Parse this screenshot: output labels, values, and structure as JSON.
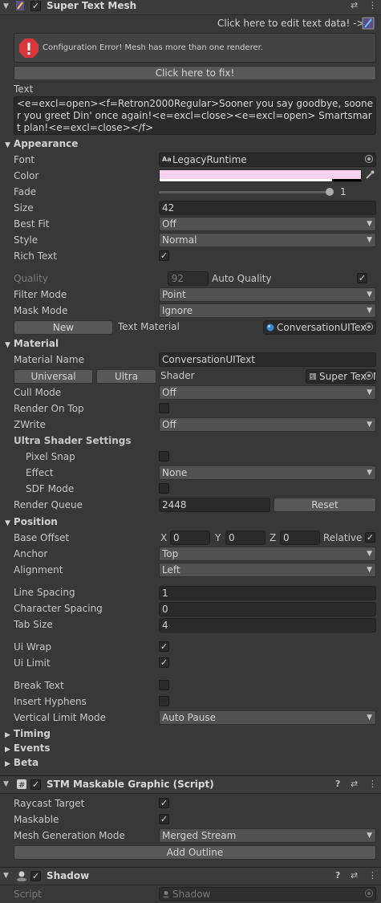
{
  "super_text_mesh": {
    "title": "Super Text Mesh",
    "edit_link": "Click here to edit text data! ->",
    "error_text": "Configuration Error! Mesh has more than one renderer.",
    "fix_button": "Click here to fix!",
    "text_label": "Text",
    "text_value": "<e=excl=open><f=Retron2000Regular>Sooner you say goodbye, sooner you greet Din' once again!<e=excl=close><e=excl=open> Smartsmart plan!<e=excl=close></f>",
    "appearance": {
      "header": "Appearance",
      "font_label": "Font",
      "font_value": "LegacyRuntime",
      "font_prefix": "Aa",
      "color_label": "Color",
      "color_value": "#f6d0ef",
      "fade_label": "Fade",
      "fade_value": "1",
      "size_label": "Size",
      "size_value": "42",
      "best_fit_label": "Best Fit",
      "best_fit_value": "Off",
      "style_label": "Style",
      "style_value": "Normal",
      "rich_text_label": "Rich Text",
      "quality_label": "Quality",
      "quality_value": "92",
      "auto_quality_label": "Auto Quality",
      "filter_mode_label": "Filter Mode",
      "filter_mode_value": "Point",
      "mask_mode_label": "Mask Mode",
      "mask_mode_value": "Ignore",
      "new_button": "New",
      "text_material_label": "Text Material",
      "text_material_value": "ConversationUIText"
    },
    "material": {
      "header": "Material",
      "name_label": "Material Name",
      "name_value": "ConversationUIText",
      "universal_button": "Universal",
      "ultra_button": "Ultra",
      "shader_label": "Shader",
      "shader_value": "Super Text Mesh",
      "cull_mode_label": "Cull Mode",
      "cull_mode_value": "Off",
      "render_on_top_label": "Render On Top",
      "zwrite_label": "ZWrite",
      "zwrite_value": "Off",
      "ultra_settings_label": "Ultra Shader Settings",
      "pixel_snap_label": "Pixel Snap",
      "effect_label": "Effect",
      "effect_value": "None",
      "sdf_mode_label": "SDF Mode",
      "render_queue_label": "Render Queue",
      "render_queue_value": "2448",
      "reset_button": "Reset"
    },
    "position": {
      "header": "Position",
      "base_offset_label": "Base Offset",
      "x_label": "X",
      "x_value": "0",
      "y_label": "Y",
      "y_value": "0",
      "z_label": "Z",
      "z_value": "0",
      "relative_label": "Relative",
      "anchor_label": "Anchor",
      "anchor_value": "Top",
      "alignment_label": "Alignment",
      "alignment_value": "Left",
      "line_spacing_label": "Line Spacing",
      "line_spacing_value": "1",
      "char_spacing_label": "Character Spacing",
      "char_spacing_value": "0",
      "tab_size_label": "Tab Size",
      "tab_size_value": "4",
      "ui_wrap_label": "Ui Wrap",
      "ui_limit_label": "Ui Limit",
      "break_text_label": "Break Text",
      "insert_hyphens_label": "Insert Hyphens",
      "vertical_limit_label": "Vertical Limit Mode",
      "vertical_limit_value": "Auto Pause"
    },
    "timing_header": "Timing",
    "events_header": "Events",
    "beta_header": "Beta"
  },
  "maskable_graphic": {
    "title": "STM Maskable Graphic (Script)",
    "raycast_label": "Raycast Target",
    "maskable_label": "Maskable",
    "mesh_gen_label": "Mesh Generation Mode",
    "mesh_gen_value": "Merged Stream",
    "add_outline_button": "Add Outline"
  },
  "shadow": {
    "title": "Shadow",
    "script_label": "Script",
    "script_value": "Shadow"
  },
  "icons": {
    "help": "?",
    "presets": "⇄",
    "menu": "⋮",
    "checkmark": "✓",
    "collapse_down": "▼",
    "collapse_right": "▶",
    "dropdown": "▼",
    "error": "!"
  },
  "colors": {
    "error_red": "#d9363e",
    "error_bg": "#434343",
    "panel_bg": "#383838"
  }
}
